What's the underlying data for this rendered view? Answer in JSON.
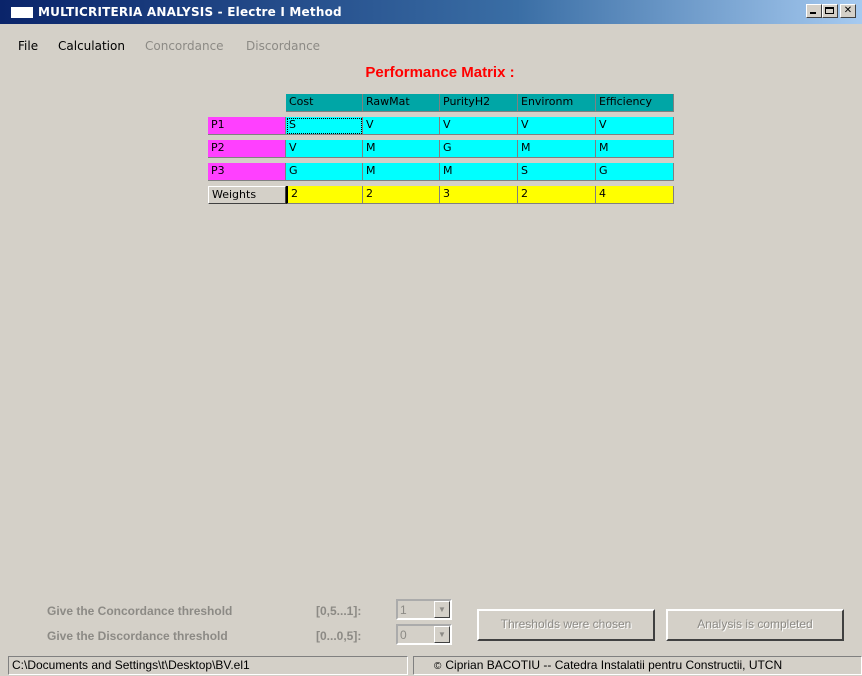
{
  "window": {
    "title": "MULTICRITERIA ANALYSIS - Electre I Method"
  },
  "menu": [
    "File",
    "Calculation",
    "Concordance",
    "Discordance"
  ],
  "matrix": {
    "title": "Performance Matrix :",
    "headers": [
      "Cost",
      "RawMat",
      "PurityH2",
      "Environm",
      "Efficiency"
    ],
    "rows": [
      {
        "label": "P1",
        "values": [
          "S",
          "V",
          "V",
          "V",
          "V"
        ]
      },
      {
        "label": "P2",
        "values": [
          "V",
          "M",
          "G",
          "M",
          "M"
        ]
      },
      {
        "label": "P3",
        "values": [
          "G",
          "M",
          "M",
          "S",
          "G"
        ]
      }
    ],
    "weights": {
      "label": "Weights",
      "values": [
        "2",
        "2",
        "3",
        "2",
        "4"
      ]
    }
  },
  "thresholds": {
    "concordance": {
      "label": "Give the Concordance threshold",
      "range": "[0,5...1]:",
      "value": "1"
    },
    "discordance": {
      "label": "Give the Discordance threshold",
      "range": "[0...0,5]:",
      "value": "0"
    }
  },
  "buttons": {
    "chosen": "Thresholds were chosen",
    "completed": "Analysis is completed"
  },
  "statusbar": {
    "path": "C:\\Documents and Settings\\t\\Desktop\\BV.el1",
    "copyright_symbol": "©",
    "credit": "Ciprian BACOTIU -- Catedra Instalatii pentru Constructii, UTCN"
  },
  "colors": {
    "title_red": "#ff0000",
    "header_teal": "#00a6a6",
    "cell_cyan": "#00ffff",
    "row_magenta": "#ff40ff",
    "weights_yellow": "#ffff00"
  }
}
